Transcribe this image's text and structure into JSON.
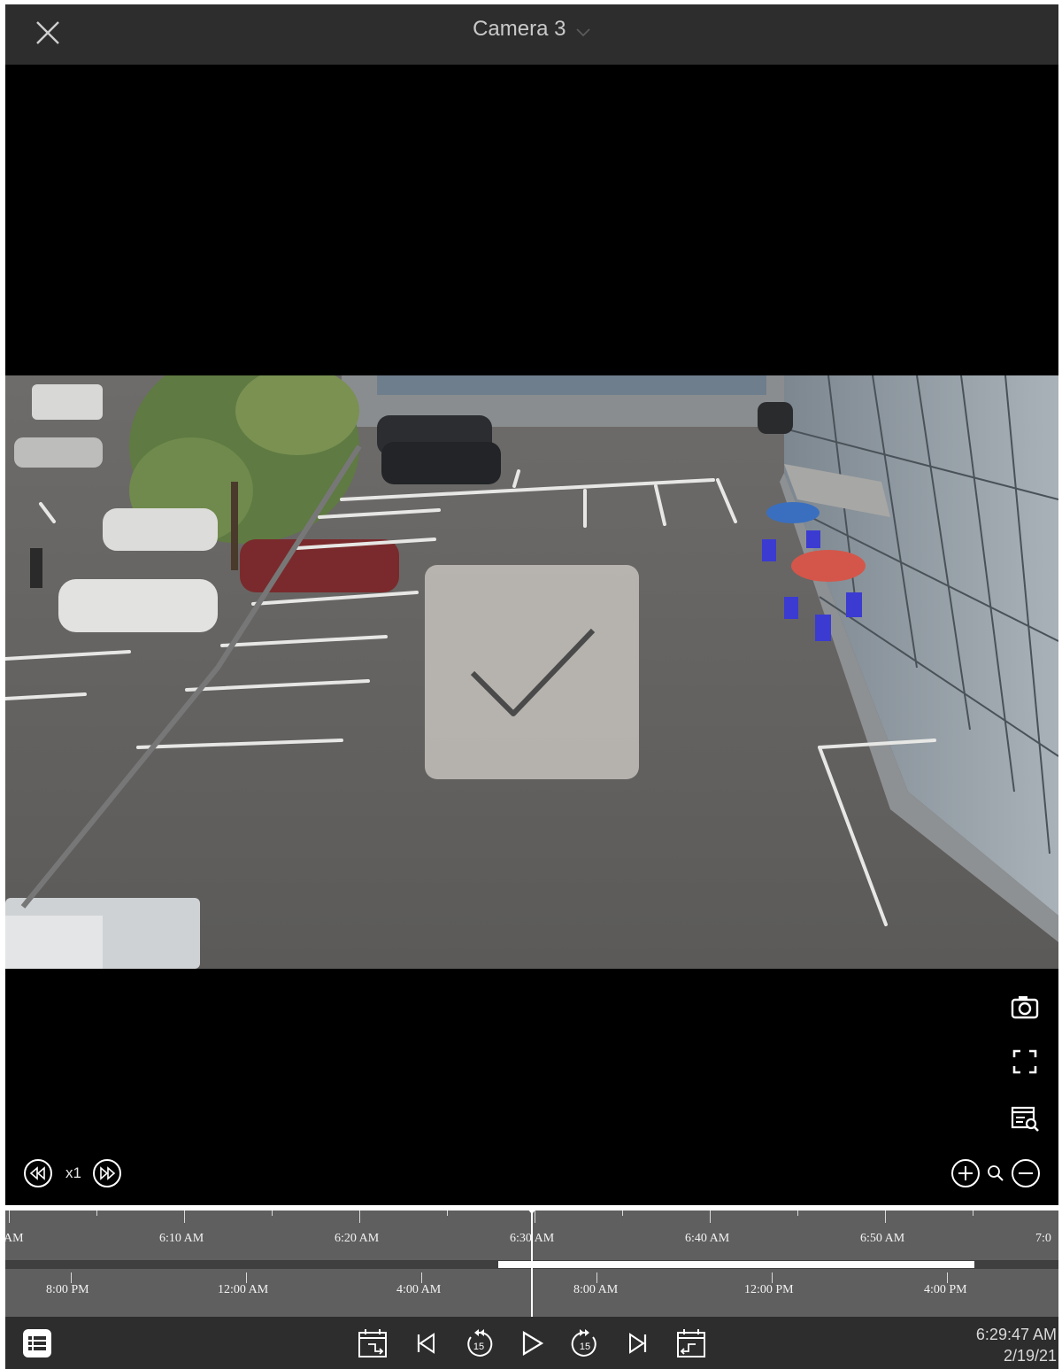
{
  "header": {
    "title": "Camera 3",
    "close_icon": "close-icon",
    "dropdown_icon": "chevron-down-icon"
  },
  "video": {
    "overlay_icon": "checkmark-icon"
  },
  "side_tools": [
    "camera-icon",
    "fullscreen-icon",
    "search-archive-icon"
  ],
  "playback": {
    "speed_label": "x1",
    "slower_icon": "rewind-icon",
    "faster_icon": "fast-forward-icon"
  },
  "zoom": {
    "in_icon": "zoom-in-icon",
    "magnifier_icon": "magnifier-icon",
    "out_icon": "zoom-out-icon"
  },
  "timeline": {
    "fine_labels": [
      "AM",
      "6:10 AM",
      "6:20 AM",
      "6:30 AM",
      "6:40 AM",
      "6:50 AM",
      "7:0"
    ],
    "coarse_labels": [
      "8:00 PM",
      "12:00 AM",
      "4:00 AM",
      "8:00 AM",
      "12:00 PM",
      "4:00 PM"
    ]
  },
  "bottom": {
    "list_icon": "list-icon",
    "controls": [
      "calendar-back-icon",
      "skip-previous-icon",
      "rewind-15-icon",
      "play-icon",
      "forward-15-icon",
      "skip-next-icon",
      "calendar-forward-icon"
    ],
    "time": "6:29:47 AM",
    "date": "2/19/21"
  },
  "colors": {
    "bar_bg": "#2d2d2d",
    "timeline_bg": "#5f5f5f",
    "tile": "#c8c4c0"
  }
}
